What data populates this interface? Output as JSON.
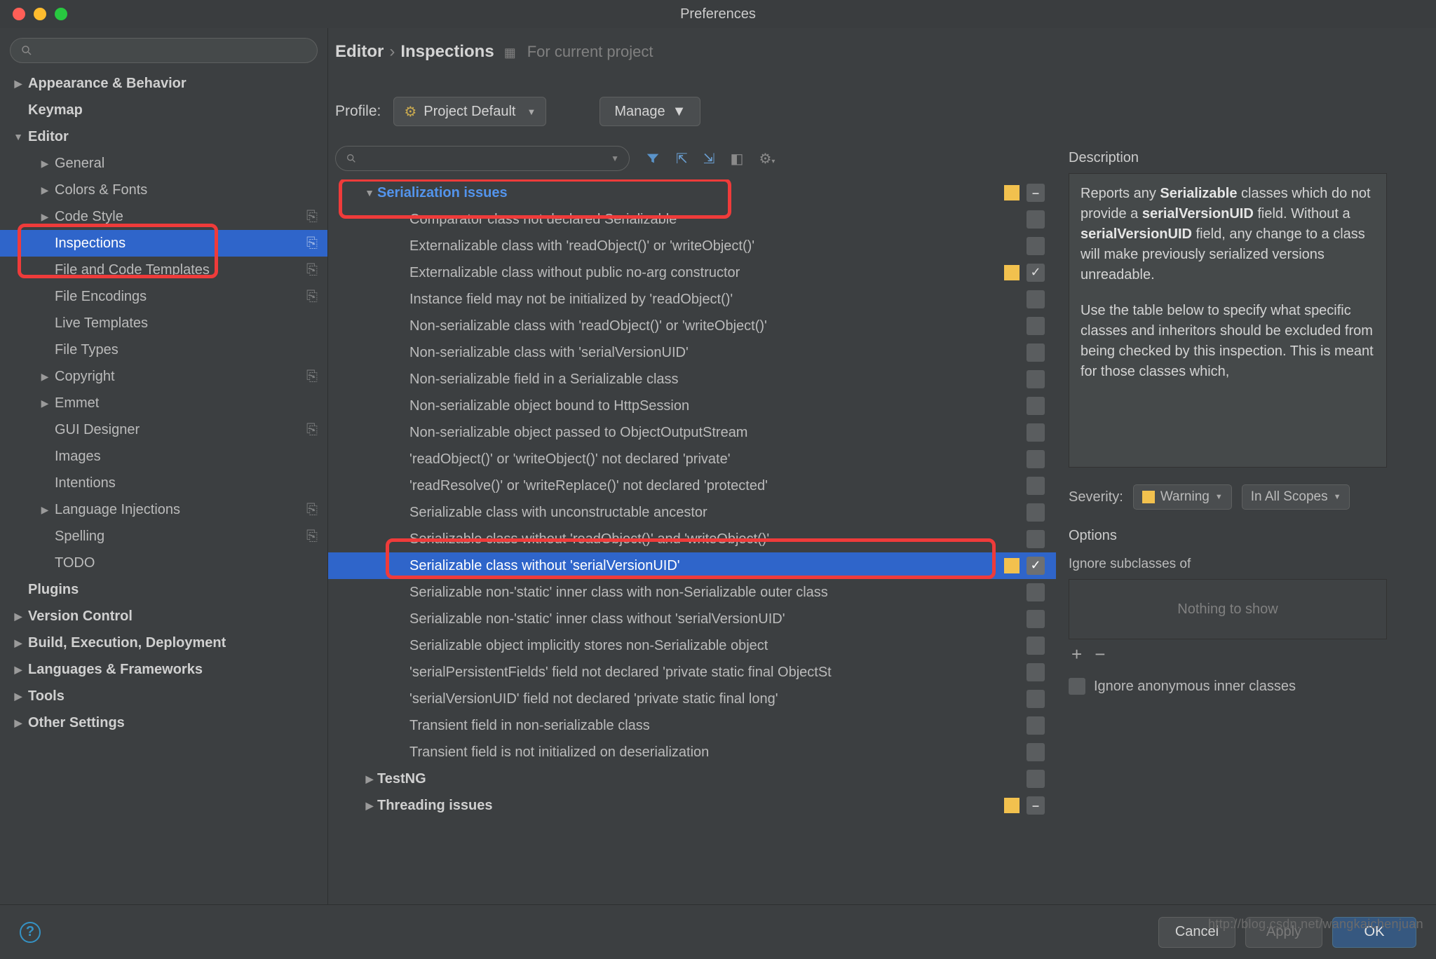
{
  "window": {
    "title": "Preferences"
  },
  "breadcrumb": {
    "section": "Editor",
    "page": "Inspections",
    "scope": "For current project"
  },
  "sidebar": {
    "search_placeholder": "",
    "items": [
      {
        "label": "Appearance & Behavior",
        "level": 0,
        "arrow": "▶",
        "bold": true
      },
      {
        "label": "Keymap",
        "level": 0,
        "arrow": "",
        "bold": true
      },
      {
        "label": "Editor",
        "level": 0,
        "arrow": "▼",
        "bold": true
      },
      {
        "label": "General",
        "level": 1,
        "arrow": "▶"
      },
      {
        "label": "Colors & Fonts",
        "level": 1,
        "arrow": "▶"
      },
      {
        "label": "Code Style",
        "level": 1,
        "arrow": "▶",
        "copy": true
      },
      {
        "label": "Inspections",
        "level": 1,
        "arrow": "",
        "selected": true,
        "copy": true
      },
      {
        "label": "File and Code Templates",
        "level": 1,
        "arrow": "",
        "copy": true
      },
      {
        "label": "File Encodings",
        "level": 1,
        "arrow": "",
        "copy": true
      },
      {
        "label": "Live Templates",
        "level": 1,
        "arrow": ""
      },
      {
        "label": "File Types",
        "level": 1,
        "arrow": ""
      },
      {
        "label": "Copyright",
        "level": 1,
        "arrow": "▶",
        "copy": true
      },
      {
        "label": "Emmet",
        "level": 1,
        "arrow": "▶"
      },
      {
        "label": "GUI Designer",
        "level": 1,
        "arrow": "",
        "copy": true
      },
      {
        "label": "Images",
        "level": 1,
        "arrow": ""
      },
      {
        "label": "Intentions",
        "level": 1,
        "arrow": ""
      },
      {
        "label": "Language Injections",
        "level": 1,
        "arrow": "▶",
        "copy": true
      },
      {
        "label": "Spelling",
        "level": 1,
        "arrow": "",
        "copy": true
      },
      {
        "label": "TODO",
        "level": 1,
        "arrow": ""
      },
      {
        "label": "Plugins",
        "level": 0,
        "arrow": "",
        "bold": true
      },
      {
        "label": "Version Control",
        "level": 0,
        "arrow": "▶",
        "bold": true
      },
      {
        "label": "Build, Execution, Deployment",
        "level": 0,
        "arrow": "▶",
        "bold": true
      },
      {
        "label": "Languages & Frameworks",
        "level": 0,
        "arrow": "▶",
        "bold": true
      },
      {
        "label": "Tools",
        "level": 0,
        "arrow": "▶",
        "bold": true
      },
      {
        "label": "Other Settings",
        "level": 0,
        "arrow": "▶",
        "bold": true
      }
    ]
  },
  "profile": {
    "label": "Profile:",
    "value": "Project Default",
    "manage": "Manage"
  },
  "inspections": {
    "group_label": "Serialization issues",
    "items": [
      {
        "label": "Comparator class not declared Serializable"
      },
      {
        "label": "Externalizable class with 'readObject()' or 'writeObject()'"
      },
      {
        "label": "Externalizable class without public no-arg constructor",
        "severity": "warn",
        "checked": true
      },
      {
        "label": "Instance field may not be initialized by 'readObject()'"
      },
      {
        "label": "Non-serializable class with 'readObject()' or 'writeObject()'"
      },
      {
        "label": "Non-serializable class with 'serialVersionUID'"
      },
      {
        "label": "Non-serializable field in a Serializable class"
      },
      {
        "label": "Non-serializable object bound to HttpSession"
      },
      {
        "label": "Non-serializable object passed to ObjectOutputStream"
      },
      {
        "label": "'readObject()' or 'writeObject()' not declared 'private'"
      },
      {
        "label": "'readResolve()' or 'writeReplace()' not declared 'protected'"
      },
      {
        "label": "Serializable class with unconstructable ancestor"
      },
      {
        "label": "Serializable class without 'readObject()' and 'writeObject()'"
      },
      {
        "label": "Serializable class without 'serialVersionUID'",
        "severity": "warn",
        "checked": true,
        "selected": true
      },
      {
        "label": "Serializable non-'static' inner class with non-Serializable outer class"
      },
      {
        "label": "Serializable non-'static' inner class without 'serialVersionUID'"
      },
      {
        "label": "Serializable object implicitly stores non-Serializable object"
      },
      {
        "label": "'serialPersistentFields' field not declared 'private static final ObjectSt"
      },
      {
        "label": "'serialVersionUID' field not declared 'private static final long'"
      },
      {
        "label": "Transient field in non-serializable class"
      },
      {
        "label": "Transient field is not initialized on deserialization"
      }
    ],
    "after_groups": [
      {
        "label": "TestNG",
        "arrow": "▶"
      },
      {
        "label": "Threading issues",
        "arrow": "▶",
        "severity": "warn",
        "dash": true
      }
    ]
  },
  "detail": {
    "desc_heading": "Description",
    "desc_p1a": "Reports any ",
    "desc_p1b": "Serializable",
    "desc_p1c": " classes which do not provide a ",
    "desc_p1d": "serialVersionUID",
    "desc_p1e": " field. Without a ",
    "desc_p1f": "serialVersionUID",
    "desc_p1g": " field, any change to a class will make previously serialized versions unreadable.",
    "desc_p2": "Use the table below to specify what specific classes and inheritors should be excluded from being checked by this inspection. This is meant for those classes which,",
    "severity_label": "Severity:",
    "severity_value": "Warning",
    "scope_value": "In All Scopes",
    "options_heading": "Options",
    "ignore_sub_label": "Ignore subclasses of",
    "empty_table": "Nothing to show",
    "ignore_anon": "Ignore anonymous inner classes"
  },
  "footer": {
    "cancel": "Cancel",
    "apply": "Apply",
    "ok": "OK"
  },
  "watermark": "http://blog.csdn.net/wangkaichenjuan"
}
